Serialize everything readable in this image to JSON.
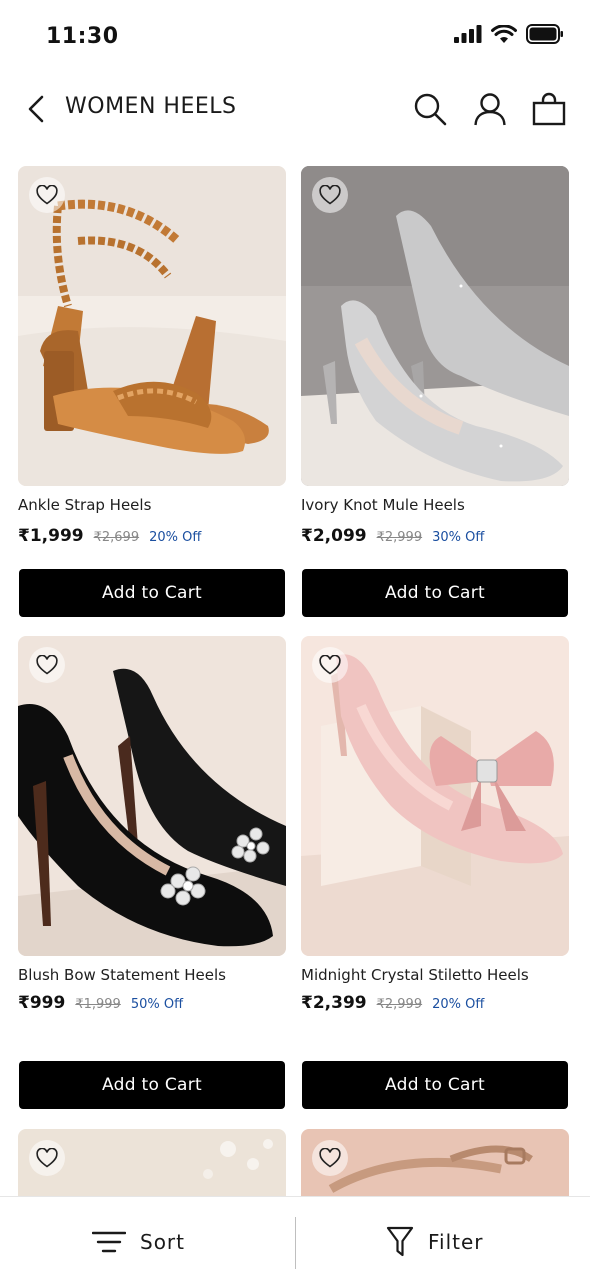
{
  "status": {
    "time": "11:30"
  },
  "header": {
    "title": "WOMEN HEELS"
  },
  "products": [
    {
      "name": "Ankle Strap Heels",
      "price": "₹1,999",
      "mrp": "₹2,699",
      "discount": "20% Off",
      "cta": "Add to Cart"
    },
    {
      "name": "Ivory Knot Mule Heels",
      "price": "₹2,099",
      "mrp": "₹2,999",
      "discount": "30% Off",
      "cta": "Add to Cart"
    },
    {
      "name": "Blush Bow Statement Heels",
      "price": "₹999",
      "mrp": "₹1,999",
      "discount": "50% Off",
      "cta": "Add to Cart"
    },
    {
      "name": "Midnight Crystal Stiletto Heels",
      "price": "₹2,399",
      "mrp": "₹2,999",
      "discount": "20% Off",
      "cta": "Add to Cart"
    }
  ],
  "bottom_bar": {
    "sort_label": "Sort",
    "filter_label": "Filter"
  },
  "icons": {
    "back": "chevron-left-icon",
    "search": "search-icon",
    "account": "user-icon",
    "cart": "shopping-bag-icon",
    "wishlist": "heart-icon",
    "sort": "sort-lines-icon",
    "filter": "funnel-icon"
  }
}
